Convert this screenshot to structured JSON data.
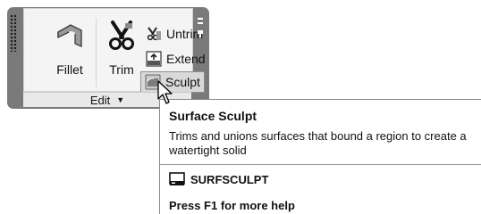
{
  "ribbon": {
    "panel_title": "Edit",
    "panel_dropdown_icon": "caret-down-icon",
    "buttons": {
      "fillet": {
        "label": "Fillet",
        "icon": "fillet-surface-icon"
      },
      "trim": {
        "label": "Trim",
        "icon": "scissors-icon"
      },
      "untrim": {
        "label": "Untrim",
        "icon": "untrim-icon"
      },
      "extend": {
        "label": "Extend",
        "icon": "extend-icon"
      },
      "sculpt": {
        "label": "Sculpt",
        "icon": "sculpt-icon"
      }
    }
  },
  "tooltip": {
    "title": "Surface Sculpt",
    "description_line1": "Trims and unions surfaces that bound a region to create a",
    "description_line2": "watertight solid",
    "command_name": "SURFSCULPT",
    "command_icon": "command-line-icon",
    "help_text": "Press F1 for more help"
  }
}
